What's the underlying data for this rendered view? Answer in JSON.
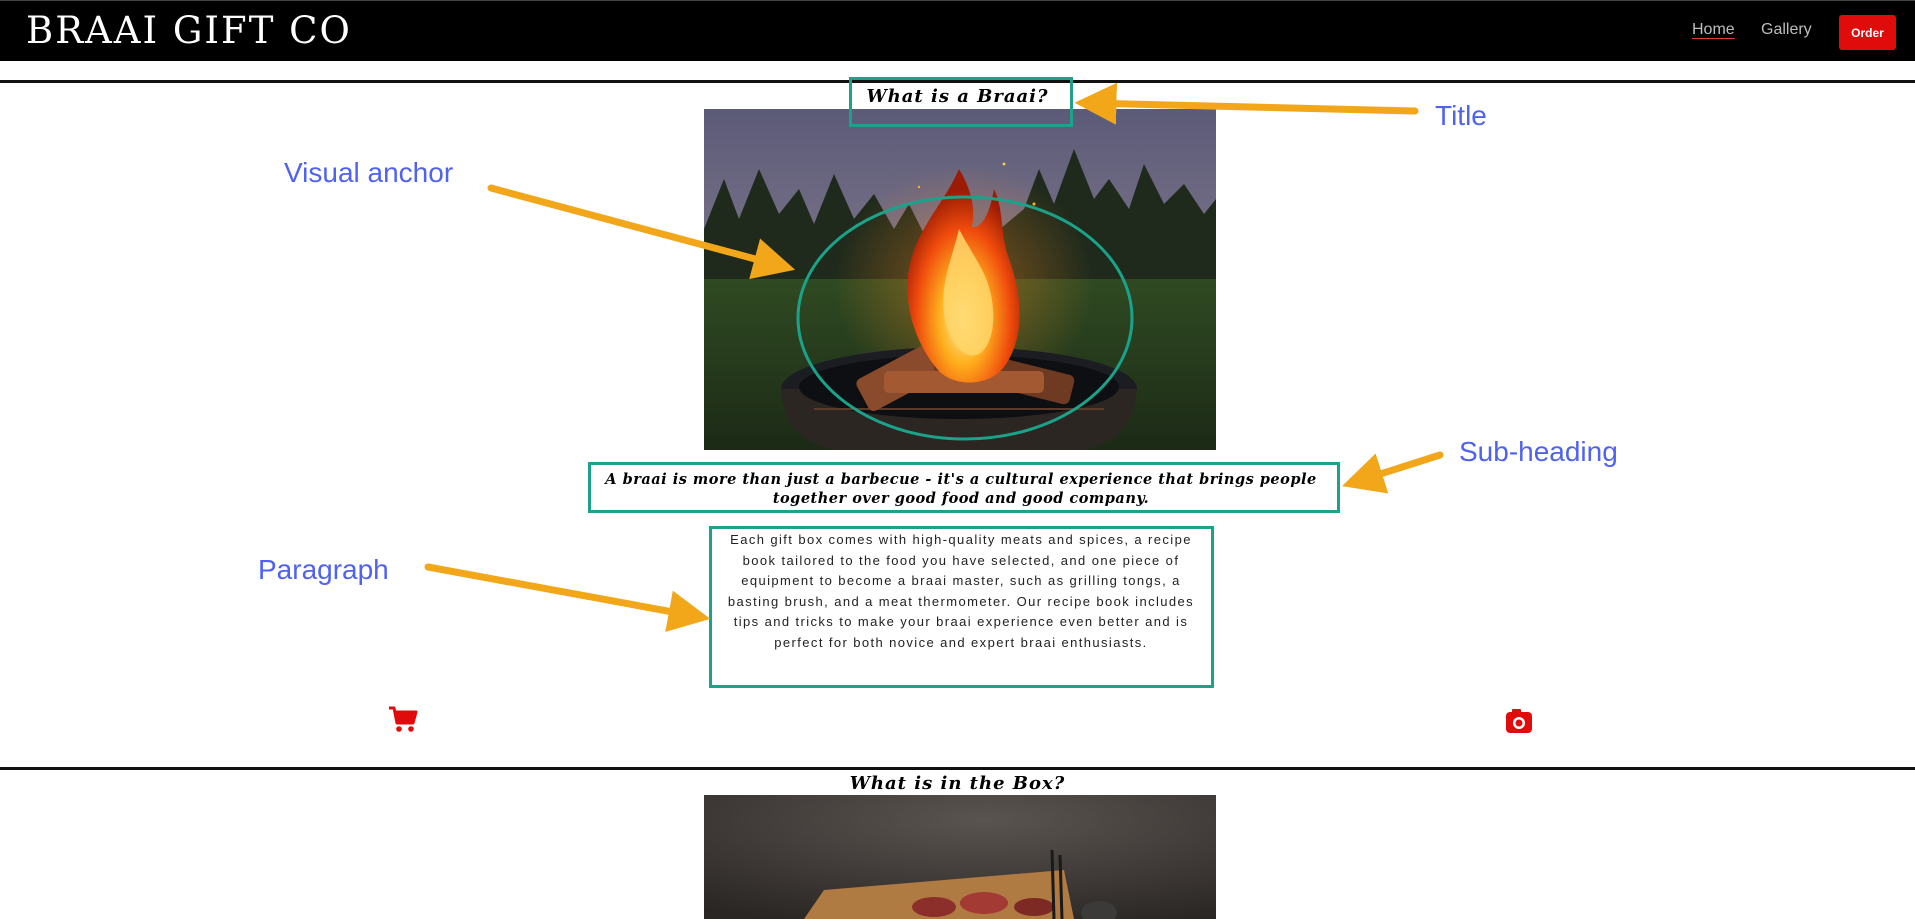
{
  "header": {
    "brand": "BRAAI GIFT CO",
    "nav": {
      "home": "Home",
      "gallery": "Gallery",
      "order": "Order"
    }
  },
  "section1": {
    "title": "What is a Braai?",
    "subheading": "A braai is more than just a barbecue - it's a cultural experience that brings people together over good food and good company.",
    "paragraph": "Each gift box comes with high-quality meats and spices, a recipe book tailored to the food you have selected, and one piece of equipment to become a braai master, such as grilling tongs, a basting brush, and a meat thermometer. Our recipe book includes tips and tricks to make your braai experience even better and is perfect for both novice and expert braai enthusiasts."
  },
  "section2": {
    "title": "What is in the Box?"
  },
  "annotations": {
    "title": "Title",
    "visual_anchor": "Visual anchor",
    "sub_heading": "Sub-heading",
    "paragraph": "Paragraph"
  },
  "icons": {
    "left": "cart-icon",
    "right": "camera-icon"
  },
  "colors": {
    "accent": "#e00b0b",
    "annotation_box": "#1aa38a",
    "annotation_arrow": "#f2a619",
    "annotation_text": "#4f62f0"
  }
}
